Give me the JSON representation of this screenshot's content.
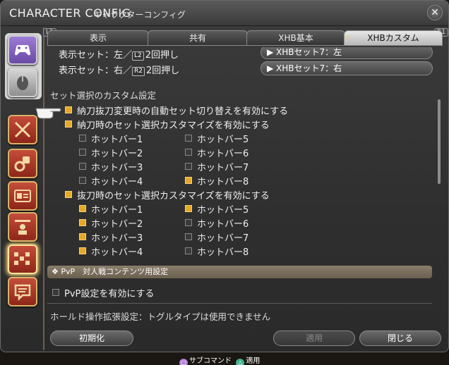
{
  "window": {
    "title_main": "CHARACTER CONFIG",
    "title_sub": "キャラクターコンフィグ",
    "close_icon": "close-icon"
  },
  "tabs": {
    "left_hint": "L1",
    "right_hint": "R1",
    "items": [
      {
        "label": "表示",
        "active": false
      },
      {
        "label": "共有",
        "active": false
      },
      {
        "label": "XHB基本",
        "active": false
      },
      {
        "label": "XHBカスタム",
        "active": true
      }
    ]
  },
  "display_sets": [
    {
      "label_prefix": "表示セット：左／",
      "key": "L2",
      "label_suffix": "2回押し",
      "value": "▶ XHBセット7：左"
    },
    {
      "label_prefix": "表示セット：右／",
      "key": "R2",
      "label_suffix": "2回押し",
      "value": "▶ XHBセット7：右"
    }
  ],
  "custom_section": {
    "heading": "セット選択のカスタム設定",
    "auto_switch": {
      "label": "納刀抜刀変更時の自動セット切り替えを有効にする",
      "checked": true
    },
    "sheathed": {
      "label": "納刀時のセット選択カスタマイズを有効にする",
      "checked": true,
      "hotbars": [
        {
          "label": "ホットバー1",
          "checked": false
        },
        {
          "label": "ホットバー5",
          "checked": false
        },
        {
          "label": "ホットバー2",
          "checked": false
        },
        {
          "label": "ホットバー6",
          "checked": false
        },
        {
          "label": "ホットバー3",
          "checked": false
        },
        {
          "label": "ホットバー7",
          "checked": false
        },
        {
          "label": "ホットバー4",
          "checked": false
        },
        {
          "label": "ホットバー8",
          "checked": true
        }
      ]
    },
    "drawn": {
      "label": "抜刀時のセット選択カスタマイズを有効にする",
      "checked": true,
      "hotbars": [
        {
          "label": "ホットバー1",
          "checked": true
        },
        {
          "label": "ホットバー5",
          "checked": true
        },
        {
          "label": "ホットバー2",
          "checked": true
        },
        {
          "label": "ホットバー6",
          "checked": false
        },
        {
          "label": "ホットバー3",
          "checked": true
        },
        {
          "label": "ホットバー7",
          "checked": false
        },
        {
          "label": "ホットバー4",
          "checked": true
        },
        {
          "label": "ホットバー8",
          "checked": false
        }
      ]
    }
  },
  "pvp": {
    "header_icon": "diamond-cluster-icon",
    "header": "PvP　対人戦コンテンツ用設定",
    "enable": {
      "label": "PvP設定を有効にする",
      "checked": false
    }
  },
  "hold_note": "ホールド操作拡張設定：トグルタイプは使用できません",
  "footer": {
    "reset": "初期化",
    "apply": "適用",
    "close": "閉じる"
  },
  "hints": {
    "sub_command": "サブコマンド",
    "apply": "適用"
  },
  "colors": {
    "checkbox_on": "#e5a92a",
    "sidebar_red": "#b03a28",
    "tab_active": "#d6d6d6"
  }
}
